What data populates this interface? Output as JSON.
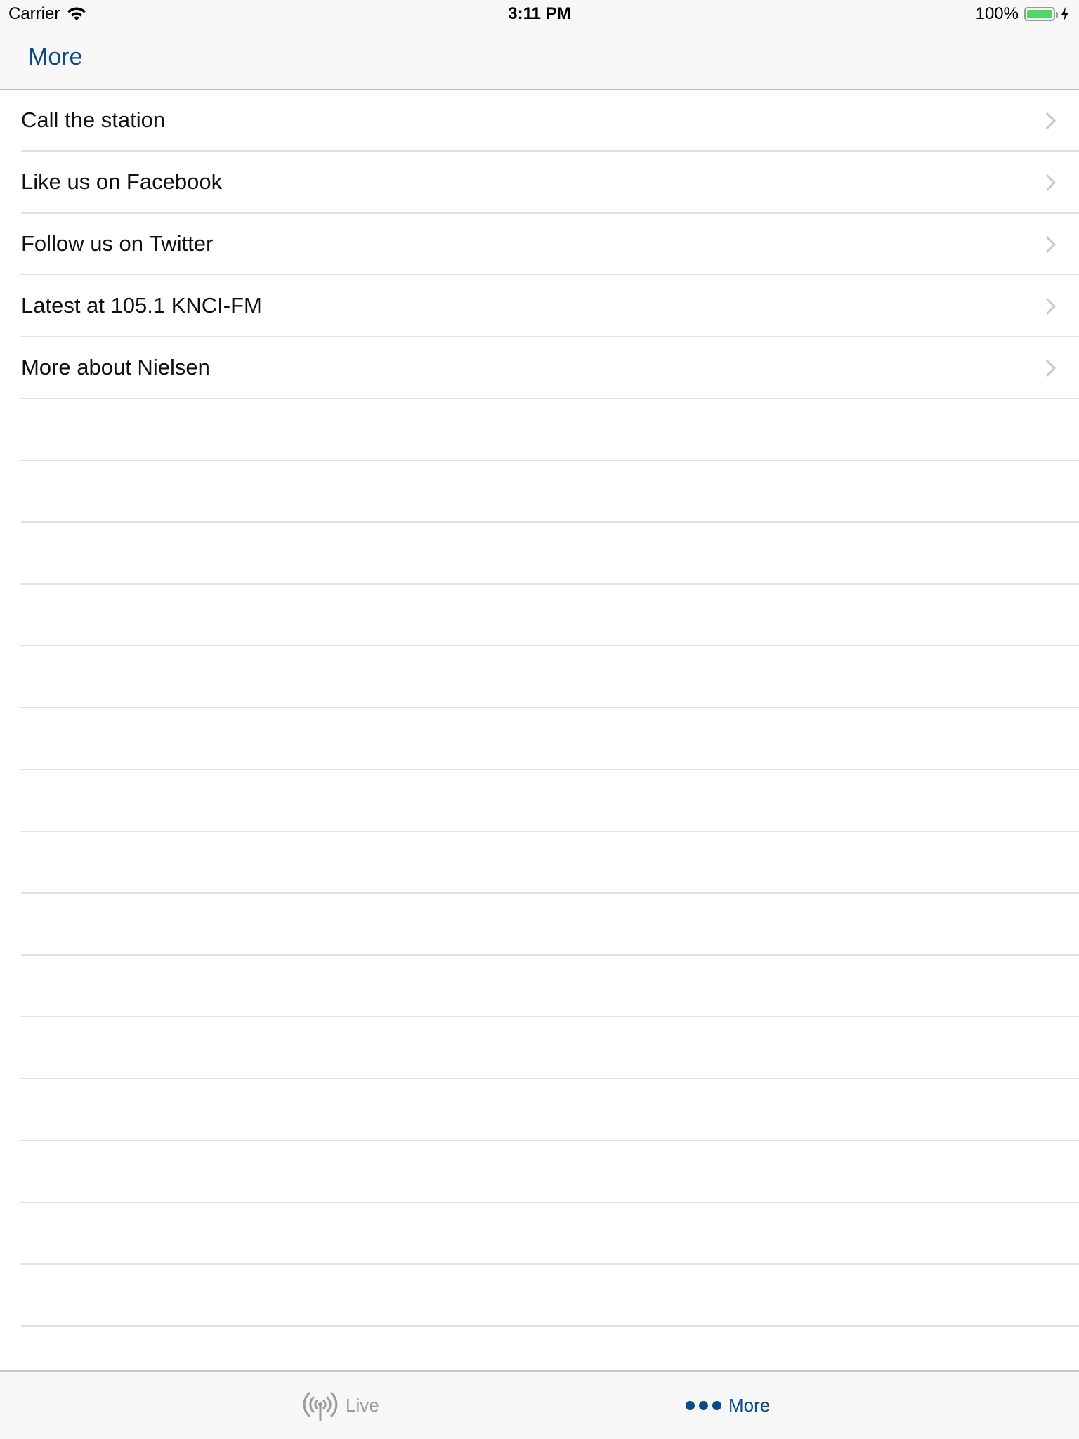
{
  "status_bar": {
    "carrier": "Carrier",
    "time": "3:11 PM",
    "battery": "100%",
    "battery_color": "#4cd964"
  },
  "nav": {
    "title": "More",
    "accent": "#0a4a8a"
  },
  "list": {
    "items": [
      {
        "label": "Call the station"
      },
      {
        "label": "Like us on Facebook"
      },
      {
        "label": "Follow us on Twitter"
      },
      {
        "label": "Latest at 105.1 KNCI-FM"
      },
      {
        "label": "More about Nielsen"
      }
    ],
    "empty_rows": 16
  },
  "tabs": [
    {
      "label": "Live",
      "icon": "broadcast-icon",
      "selected": false
    },
    {
      "label": "More",
      "icon": "more-dots-icon",
      "selected": true
    }
  ]
}
